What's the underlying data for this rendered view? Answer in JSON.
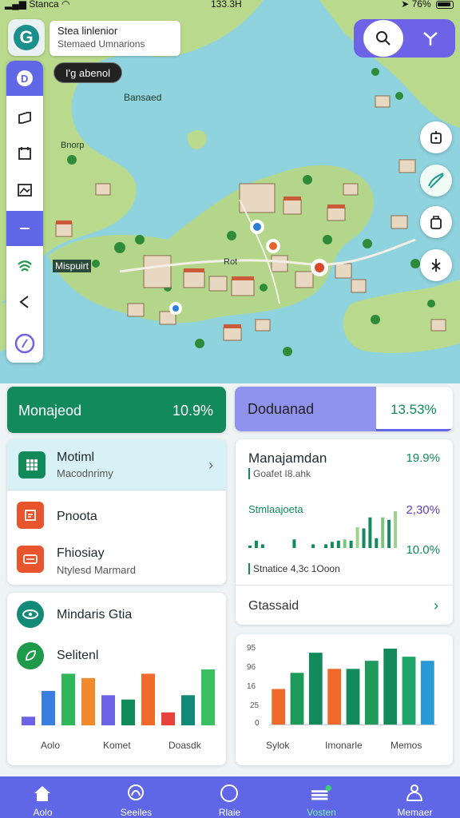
{
  "status_bar": {
    "carrier": "Stanca",
    "time": "133.3H",
    "battery": "76%"
  },
  "header": {
    "title": "Stea linlenior",
    "subtitle": "Stemaed Umnarions",
    "map_pill": "I'g abenol"
  },
  "map_labels": [
    "Bansaed",
    "Bnorp",
    "Mispuirt",
    "Rot"
  ],
  "rail_icons": [
    "app-badge-icon",
    "map-layer-icon",
    "calendar-icon",
    "image-icon",
    "minus-icon",
    "signal-icon",
    "back-icon",
    "compass-icon"
  ],
  "fab_icons": [
    "marker-icon",
    "route-icon",
    "bag-icon",
    "tool-icon"
  ],
  "stats": {
    "left": {
      "label": "Monajeod",
      "value": "10.9%"
    },
    "right": {
      "label": "Doduanad",
      "value": "13.53%"
    }
  },
  "list": {
    "items": [
      {
        "title": "Motiml",
        "subtitle": "Macodnrimy"
      },
      {
        "title": "Pnoota",
        "subtitle": ""
      },
      {
        "title": "Fhiosiay",
        "subtitle": "Ntylesd Marmard"
      }
    ]
  },
  "finance": {
    "title": "Manajamdan",
    "title_value": "19.9%",
    "subtitle": "Goafet I8.ahk",
    "chart_title": "Stmlaajoeta",
    "value1": "2,30%",
    "value2": "10.0%",
    "footer": "Stnatice 4,3c 1Ooon",
    "link": "Gtassaid"
  },
  "cards": {
    "card1": {
      "row1": "Mindaris Gtia",
      "row2": "Selitenl"
    },
    "chart1_xlabels": [
      "Aolo",
      "Komet",
      "Doasdk"
    ],
    "chart2_xlabels": [
      "Sylok",
      "Imonarle",
      "Memos"
    ],
    "chart2_yticks": [
      "95",
      "96",
      "16",
      "25",
      "0"
    ]
  },
  "nav": {
    "items": [
      {
        "label": "Aolo"
      },
      {
        "label": "Seeiles"
      },
      {
        "label": "Rlaie"
      },
      {
        "label": "Vosten"
      },
      {
        "label": "Memaer"
      }
    ]
  },
  "colors": {
    "accent": "#5f67e6",
    "green": "#128a5c",
    "teal": "#1a8f8c",
    "water": "#8fd3df",
    "land": "#b8d98a"
  },
  "chart_data": [
    {
      "type": "bar",
      "categories": [
        "1",
        "2",
        "3",
        "4",
        "5",
        "6",
        "7",
        "8",
        "9",
        "10",
        "11",
        "12",
        "13",
        "14",
        "15",
        "16",
        "17",
        "18",
        "19",
        "20",
        "21",
        "22",
        "23",
        "24"
      ],
      "values": [
        2,
        6,
        3,
        0,
        0,
        0,
        0,
        7,
        0,
        0,
        3,
        0,
        3,
        5,
        6,
        7,
        6,
        17,
        16,
        25,
        8,
        25,
        23,
        30
      ],
      "xlabel": "",
      "ylabel": ""
    },
    {
      "type": "bar",
      "categories": [
        "1",
        "2",
        "3",
        "4",
        "5",
        "6",
        "7",
        "8",
        "9",
        "10"
      ],
      "values": [
        2,
        8,
        12,
        11,
        7,
        6,
        12,
        3,
        7,
        13
      ],
      "xlabel": "",
      "ylabel": ""
    },
    {
      "type": "bar",
      "categories": [
        "1",
        "2",
        "3",
        "4",
        "5",
        "6",
        "7",
        "8",
        "9"
      ],
      "values": [
        9,
        13,
        18,
        14,
        14,
        16,
        19,
        17,
        16
      ],
      "xlabel": "",
      "ylabel": ""
    }
  ]
}
